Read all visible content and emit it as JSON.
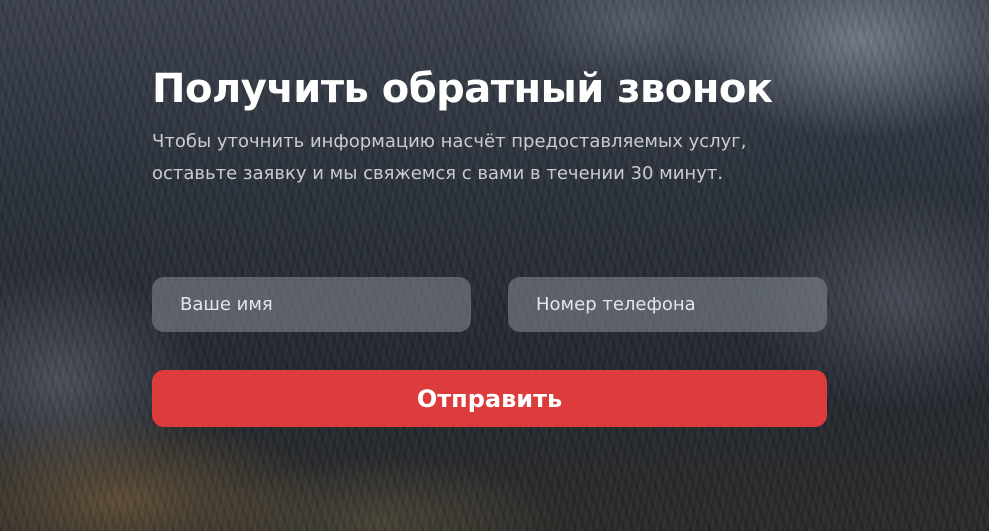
{
  "callback_form": {
    "title": "Получить обратный звонок",
    "description": "Чтобы уточнить информацию насчёт предоставляемых услуг, оставьте заявку и мы свяжемся с вами в течении 30 минут.",
    "name_field": {
      "placeholder": "Ваше имя",
      "value": ""
    },
    "phone_field": {
      "placeholder": "Номер телефона",
      "value": ""
    },
    "submit_label": "Отправить"
  },
  "colors": {
    "accent": "#dc3c3c",
    "title_text": "#ffffff",
    "body_text": "#c9ccd2",
    "field_background": "#878c96"
  }
}
